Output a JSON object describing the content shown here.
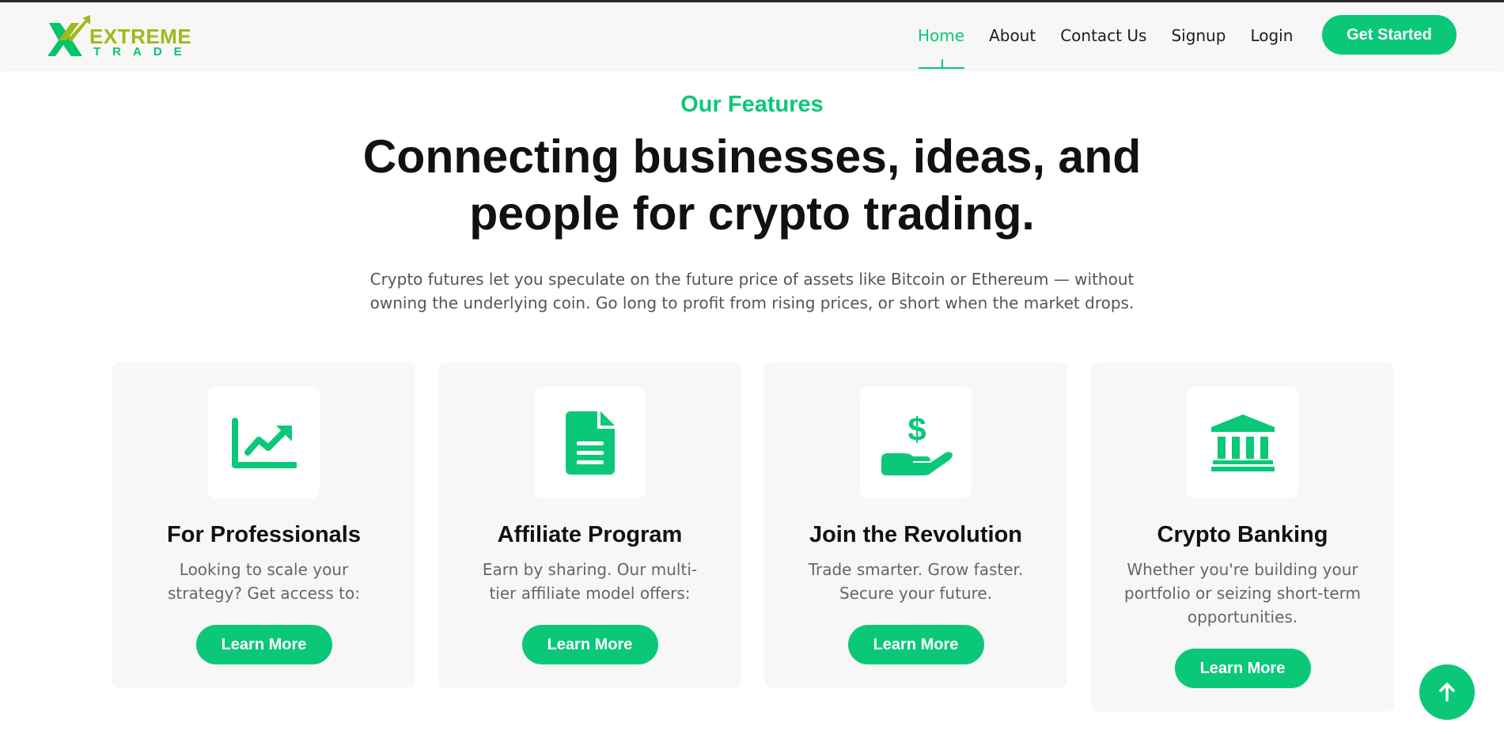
{
  "brand": {
    "word1": "EXTREME",
    "word2": "TRADE",
    "colors": {
      "olive": "#9fb91a",
      "green": "#07c46a"
    }
  },
  "nav": {
    "items": [
      {
        "label": "Home",
        "active": true
      },
      {
        "label": "About",
        "active": false
      },
      {
        "label": "Contact Us",
        "active": false
      },
      {
        "label": "Signup",
        "active": false
      },
      {
        "label": "Login",
        "active": false
      }
    ],
    "cta": "Get Started"
  },
  "features": {
    "eyebrow": "Our Features",
    "headline_line1": "Connecting businesses, ideas, and",
    "headline_line2": "people for crypto trading.",
    "lead": "Crypto futures let you speculate on the future price of assets like Bitcoin or Ethereum — without owning the underlying coin. Go long to profit from rising prices, or short when the market drops.",
    "cards": [
      {
        "icon": "chart-line-up-icon",
        "title": "For Professionals",
        "description": "Looking to scale your strategy? Get access to:",
        "button": "Learn More"
      },
      {
        "icon": "document-icon",
        "title": "Affiliate Program",
        "description": "Earn by sharing. Our multi-tier affiliate model offers:",
        "button": "Learn More"
      },
      {
        "icon": "hand-dollar-icon",
        "title": "Join the Revolution",
        "description": "Trade smarter. Grow faster. Secure your future.",
        "button": "Learn More"
      },
      {
        "icon": "bank-icon",
        "title": "Crypto Banking",
        "description": "Whether you're building your portfolio or seizing short-term opportunities.",
        "button": "Learn More"
      }
    ]
  },
  "scroll_top": {
    "icon": "arrow-up-icon"
  },
  "theme": {
    "accent": "#0bc878",
    "card_bg": "#f7f7f7",
    "heading": "#111111",
    "body_text": "#666666"
  }
}
